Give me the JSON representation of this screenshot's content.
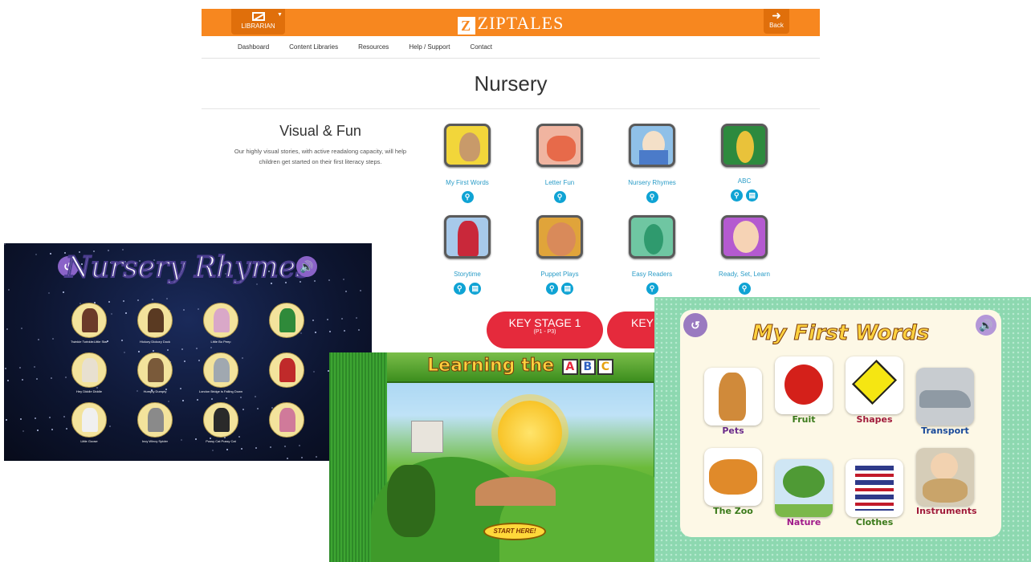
{
  "header": {
    "librarian_label": "LIBRARIAN",
    "brand": "ZIPTALES",
    "brand_mark": "Z",
    "back_label": "Back"
  },
  "nav": [
    "Dashboard",
    "Content Libraries",
    "Resources",
    "Help / Support",
    "Contact"
  ],
  "page": {
    "title": "Nursery",
    "intro_heading": "Visual & Fun",
    "intro_text": "Our highly visual stories, with active readalong capacity, will help children get started on their first literacy steps."
  },
  "tiles": [
    {
      "label": "My First Words",
      "icons": [
        "search-icon"
      ],
      "color": "#f2d63a"
    },
    {
      "label": "Letter Fun",
      "icons": [
        "search-icon"
      ],
      "color": "#e76a4a"
    },
    {
      "label": "Nursery Rhymes",
      "icons": [
        "search-icon"
      ],
      "color": "#4b7bc9"
    },
    {
      "label": "ABC",
      "icons": [
        "search-icon",
        "document-icon"
      ],
      "color": "#2d8a3e"
    },
    {
      "label": "Storytime",
      "icons": [
        "search-icon",
        "document-icon"
      ],
      "color": "#3f6fb8"
    },
    {
      "label": "Puppet Plays",
      "icons": [
        "search-icon",
        "document-icon"
      ],
      "color": "#e0a43a"
    },
    {
      "label": "Easy Readers",
      "icons": [
        "search-icon"
      ],
      "color": "#2f9a6e"
    },
    {
      "label": "Ready, Set, Learn",
      "icons": [
        "search-icon"
      ],
      "color": "#b45ad0"
    }
  ],
  "key_stages": [
    {
      "label": "KEY STAGE 1",
      "sub": "(P1 - P3)"
    },
    {
      "label": "KEY",
      "sub": ""
    }
  ],
  "screens": {
    "nursery_rhymes": {
      "title": "Nursery Rhymes",
      "items": [
        "Twinkle Twinkle Little Star",
        "Hickory Dickory Dock",
        "Little Bo Peep",
        "",
        "Hey Diddle Diddle",
        "Humpty Dumpty",
        "London Bridge is Falling Down",
        "",
        "Little Goose",
        "Incy Wincy Spider",
        "Pussy Cat Pussy Cat",
        ""
      ]
    },
    "abc": {
      "title_prefix": "Learning the",
      "blocks": [
        "A",
        "B",
        "C"
      ],
      "start": "START HERE!"
    },
    "first_words": {
      "title": "My First Words",
      "items": [
        {
          "label": "Pets",
          "color": "#d08a3a"
        },
        {
          "label": "Fruit",
          "color": "#d4201a"
        },
        {
          "label": "Shapes",
          "color": "#f5e612"
        },
        {
          "label": "Transport",
          "color": "#8f9aa4"
        },
        {
          "label": "The Zoo",
          "color": "#e08a2a"
        },
        {
          "label": "Nature",
          "color": "#4f9a35"
        },
        {
          "label": "Clothes",
          "color": "#2e3a8a"
        },
        {
          "label": "Instruments",
          "color": "#c9a46a"
        }
      ]
    }
  },
  "colors": {
    "orange": "#f7871f",
    "cyan": "#0fa3d4",
    "red": "#e52a3c"
  }
}
